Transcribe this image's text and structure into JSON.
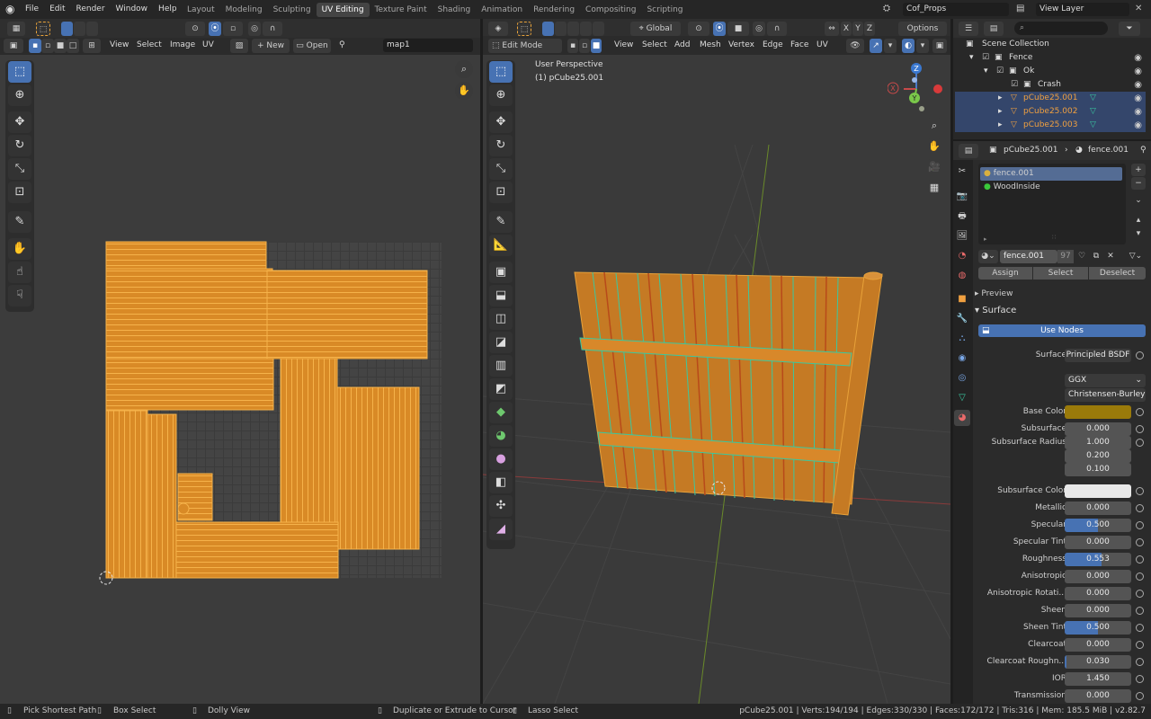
{
  "topbar": {
    "menus": [
      "File",
      "Edit",
      "Render",
      "Window",
      "Help"
    ],
    "workspaces": [
      "Layout",
      "Modeling",
      "Sculpting",
      "UV Editing",
      "Texture Paint",
      "Shading",
      "Animation",
      "Rendering",
      "Compositing",
      "Scripting"
    ],
    "active_workspace": "UV Editing",
    "scene_name": "Cof_Props",
    "view_layer": "View Layer"
  },
  "uv_editor": {
    "menus": [
      "View",
      "Select",
      "Image",
      "UV"
    ],
    "new_label": "New",
    "open_label": "Open",
    "image_name": "map1"
  },
  "viewport": {
    "mode": "Edit Mode",
    "menus": [
      "View",
      "Select",
      "Add",
      "Mesh",
      "Vertex",
      "Edge",
      "Face",
      "UV"
    ],
    "orientation": "Global",
    "options_label": "Options",
    "view_name": "User Perspective",
    "object_label": "(1) pCube25.001",
    "axes": [
      "X",
      "Y",
      "Z"
    ],
    "gizmo": {
      "x": "X",
      "y": "Y",
      "z": "Z"
    }
  },
  "outliner": {
    "rows": [
      {
        "label": "Scene Collection",
        "indent": 0,
        "selected": false
      },
      {
        "label": "Fence",
        "indent": 1,
        "selected": false
      },
      {
        "label": "Ok",
        "indent": 2,
        "selected": false
      },
      {
        "label": "Crash",
        "indent": 3,
        "selected": false
      },
      {
        "label": "pCube25.001",
        "indent": 3,
        "selected": true
      },
      {
        "label": "pCube25.002",
        "indent": 3,
        "selected": true
      },
      {
        "label": "pCube25.003",
        "indent": 3,
        "selected": true
      }
    ]
  },
  "properties": {
    "object_name": "pCube25.001",
    "material_name": "fence.001",
    "slots": [
      "fence.001",
      "WoodInside"
    ],
    "material_field": "fence.001",
    "user_count": "97",
    "assign_label": "Assign",
    "select_label": "Select",
    "deselect_label": "Deselect",
    "preview_label": "Preview",
    "surface_label": "Surface",
    "use_nodes_label": "Use Nodes",
    "surface_row_label": "Surface",
    "surface_shader": "Principled BSDF",
    "distribution": "GGX",
    "subsurface_method": "Christensen-Burley",
    "base_color_label": "Base Color",
    "base_color": "#9a7a0a",
    "subsurface_color_label": "Subsurface Color",
    "subsurface_color": "#e8e8e8",
    "params": [
      {
        "label": "Subsurface",
        "value": "0.000",
        "fill": 0
      },
      {
        "label": "Subsurface Radius",
        "value": "1.000",
        "fill": 0
      },
      {
        "label": "",
        "value": "0.200",
        "fill": 0
      },
      {
        "label": "",
        "value": "0.100",
        "fill": 0
      }
    ],
    "params2": [
      {
        "label": "Metallic",
        "value": "0.000",
        "fill": 0
      },
      {
        "label": "Specular",
        "value": "0.500",
        "fill": 0.5
      },
      {
        "label": "Specular Tint",
        "value": "0.000",
        "fill": 0
      },
      {
        "label": "Roughness",
        "value": "0.553",
        "fill": 0.553
      },
      {
        "label": "Anisotropic",
        "value": "0.000",
        "fill": 0
      },
      {
        "label": "Anisotropic Rotati...",
        "value": "0.000",
        "fill": 0
      },
      {
        "label": "Sheen",
        "value": "0.000",
        "fill": 0
      },
      {
        "label": "Sheen Tint",
        "value": "0.500",
        "fill": 0.5
      },
      {
        "label": "Clearcoat",
        "value": "0.000",
        "fill": 0
      },
      {
        "label": "Clearcoat Roughn...",
        "value": "0.030",
        "fill": 0.03
      },
      {
        "label": "IOR",
        "value": "1.450",
        "fill": 0
      },
      {
        "label": "Transmission",
        "value": "0.000",
        "fill": 0
      }
    ]
  },
  "statusbar": {
    "items": [
      "Pick Shortest Path",
      "Box Select",
      "Dolly View",
      "Duplicate or Extrude to Cursor",
      "Lasso Select"
    ],
    "stats": "pCube25.001 | Verts:194/194 | Edges:330/330 | Faces:172/172 | Tris:316 | Mem: 185.5 MiB | v2.82.7"
  },
  "colors": {
    "accent": "#4772b3",
    "uv_orange": "#e8a23a",
    "selected_text": "#f0a040"
  }
}
